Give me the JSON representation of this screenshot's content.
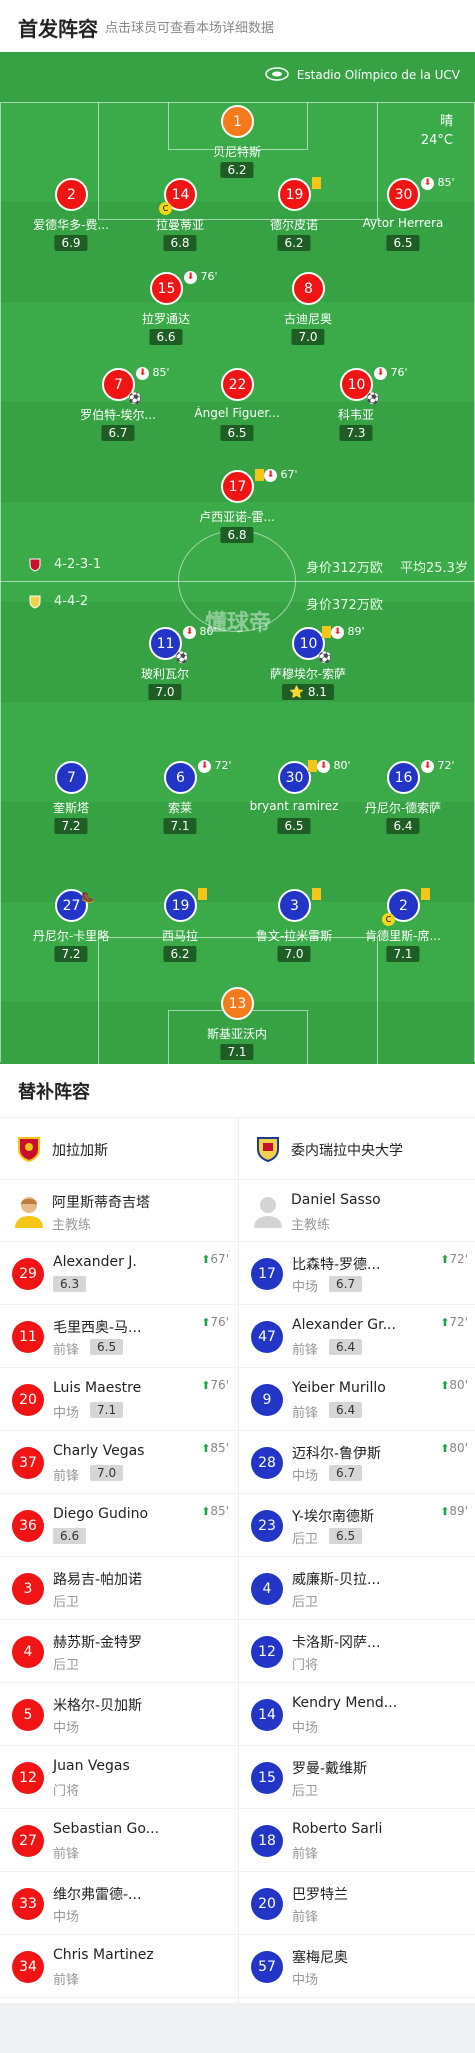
{
  "header": {
    "title": "首发阵容",
    "subtitle": "点击球员可查看本场详细数据"
  },
  "venue": "Estadio Olímpico de la UCV",
  "weather": {
    "condition": "晴",
    "temperature": "24°C"
  },
  "brand": "懂球帝",
  "home": {
    "formation": "4-2-3-1",
    "value": "身价312万欧",
    "avg_age": "平均25.3岁",
    "name": "加拉加斯",
    "coach": "阿里斯蒂奇吉塔",
    "color": "#f01414"
  },
  "away": {
    "formation": "4-4-2",
    "value": "身价372万欧",
    "name": "委内瑞拉中央大学",
    "coach": "Daniel Sasso",
    "color": "#2235c7"
  },
  "coach_role": "主教练",
  "home_players": [
    {
      "num": "1",
      "name": "贝尼特斯",
      "rating": "6.2"
    },
    {
      "num": "2",
      "name": "爱德华多-费...",
      "rating": "6.9"
    },
    {
      "num": "14",
      "name": "拉曼蒂亚",
      "rating": "6.8"
    },
    {
      "num": "19",
      "name": "德尔皮诺",
      "rating": "6.2"
    },
    {
      "num": "30",
      "name": "Aytor Herrera",
      "rating": "6.5",
      "sub": "85'"
    },
    {
      "num": "15",
      "name": "拉罗通达",
      "rating": "6.6",
      "sub": "76'"
    },
    {
      "num": "8",
      "name": "古迪尼奥",
      "rating": "7.0"
    },
    {
      "num": "7",
      "name": "罗伯特-埃尔...",
      "rating": "6.7",
      "sub": "85'"
    },
    {
      "num": "22",
      "name": "Ángel Figuer...",
      "rating": "6.5"
    },
    {
      "num": "10",
      "name": "科韦亚",
      "rating": "7.3",
      "sub": "76'"
    },
    {
      "num": "17",
      "name": "卢西亚诺-雷...",
      "rating": "6.8",
      "sub": "67'"
    }
  ],
  "away_players": [
    {
      "num": "11",
      "name": "玻利瓦尔",
      "rating": "7.0",
      "sub": "80'"
    },
    {
      "num": "10",
      "name": "萨穆埃尔-索萨",
      "rating": "8.1",
      "sub": "89'"
    },
    {
      "num": "7",
      "name": "奎斯塔",
      "rating": "7.2"
    },
    {
      "num": "6",
      "name": "索莱",
      "rating": "7.1",
      "sub": "72'"
    },
    {
      "num": "30",
      "name": "bryant ramirez",
      "rating": "6.5",
      "sub": "80'"
    },
    {
      "num": "16",
      "name": "丹尼尔-德索萨",
      "rating": "6.4",
      "sub": "72'"
    },
    {
      "num": "27",
      "name": "丹尼尔-卡里略",
      "rating": "7.2"
    },
    {
      "num": "19",
      "name": "西马拉",
      "rating": "6.2"
    },
    {
      "num": "3",
      "name": "鲁文-拉米雷斯",
      "rating": "7.0"
    },
    {
      "num": "2",
      "name": "肯德里斯-席...",
      "rating": "7.1"
    },
    {
      "num": "13",
      "name": "斯基亚沃内",
      "rating": "7.1"
    }
  ],
  "section_title": "替补阵容",
  "home_subs": [
    {
      "num": "29",
      "name": "Alexander J.",
      "pos": "",
      "rating": "6.3",
      "time": "67'"
    },
    {
      "num": "11",
      "name": "毛里西奥-马...",
      "pos": "前锋",
      "rating": "6.5",
      "time": "76'"
    },
    {
      "num": "20",
      "name": "Luis Maestre",
      "pos": "中场",
      "rating": "7.1",
      "time": "76'"
    },
    {
      "num": "37",
      "name": "Charly Vegas",
      "pos": "前锋",
      "rating": "7.0",
      "time": "85'"
    },
    {
      "num": "36",
      "name": "Diego Gudino",
      "pos": "",
      "rating": "6.6",
      "time": "85'"
    },
    {
      "num": "3",
      "name": "路易吉-帕加诺",
      "pos": "后卫"
    },
    {
      "num": "4",
      "name": "赫苏斯-金特罗",
      "pos": "后卫"
    },
    {
      "num": "5",
      "name": "米格尔-贝加斯",
      "pos": "中场"
    },
    {
      "num": "12",
      "name": "Juan Vegas",
      "pos": "门将"
    },
    {
      "num": "27",
      "name": "Sebastian Go...",
      "pos": "前锋"
    },
    {
      "num": "33",
      "name": "维尔弗雷德-...",
      "pos": "中场"
    },
    {
      "num": "34",
      "name": "Chris Martinez",
      "pos": "前锋"
    }
  ],
  "away_subs": [
    {
      "num": "17",
      "name": "比森特-罗德...",
      "pos": "中场",
      "rating": "6.7",
      "time": "72'"
    },
    {
      "num": "47",
      "name": "Alexander Gr...",
      "pos": "前锋",
      "rating": "6.4",
      "time": "72'"
    },
    {
      "num": "9",
      "name": "Yeiber Murillo",
      "pos": "前锋",
      "rating": "6.4",
      "time": "80'"
    },
    {
      "num": "28",
      "name": "迈科尔-鲁伊斯",
      "pos": "中场",
      "rating": "6.7",
      "time": "80'"
    },
    {
      "num": "23",
      "name": "Y-埃尔南德斯",
      "pos": "后卫",
      "rating": "6.5",
      "time": "89'"
    },
    {
      "num": "4",
      "name": "威廉斯-贝拉...",
      "pos": "后卫"
    },
    {
      "num": "12",
      "name": "卡洛斯-冈萨...",
      "pos": "门将"
    },
    {
      "num": "14",
      "name": "Kendry Mend...",
      "pos": "中场"
    },
    {
      "num": "15",
      "name": "罗曼-戴维斯",
      "pos": "后卫"
    },
    {
      "num": "18",
      "name": "Roberto Sarli",
      "pos": "前锋"
    },
    {
      "num": "20",
      "name": "巴罗特兰",
      "pos": "前锋"
    },
    {
      "num": "57",
      "name": "塞梅尼奥",
      "pos": "中场"
    }
  ]
}
